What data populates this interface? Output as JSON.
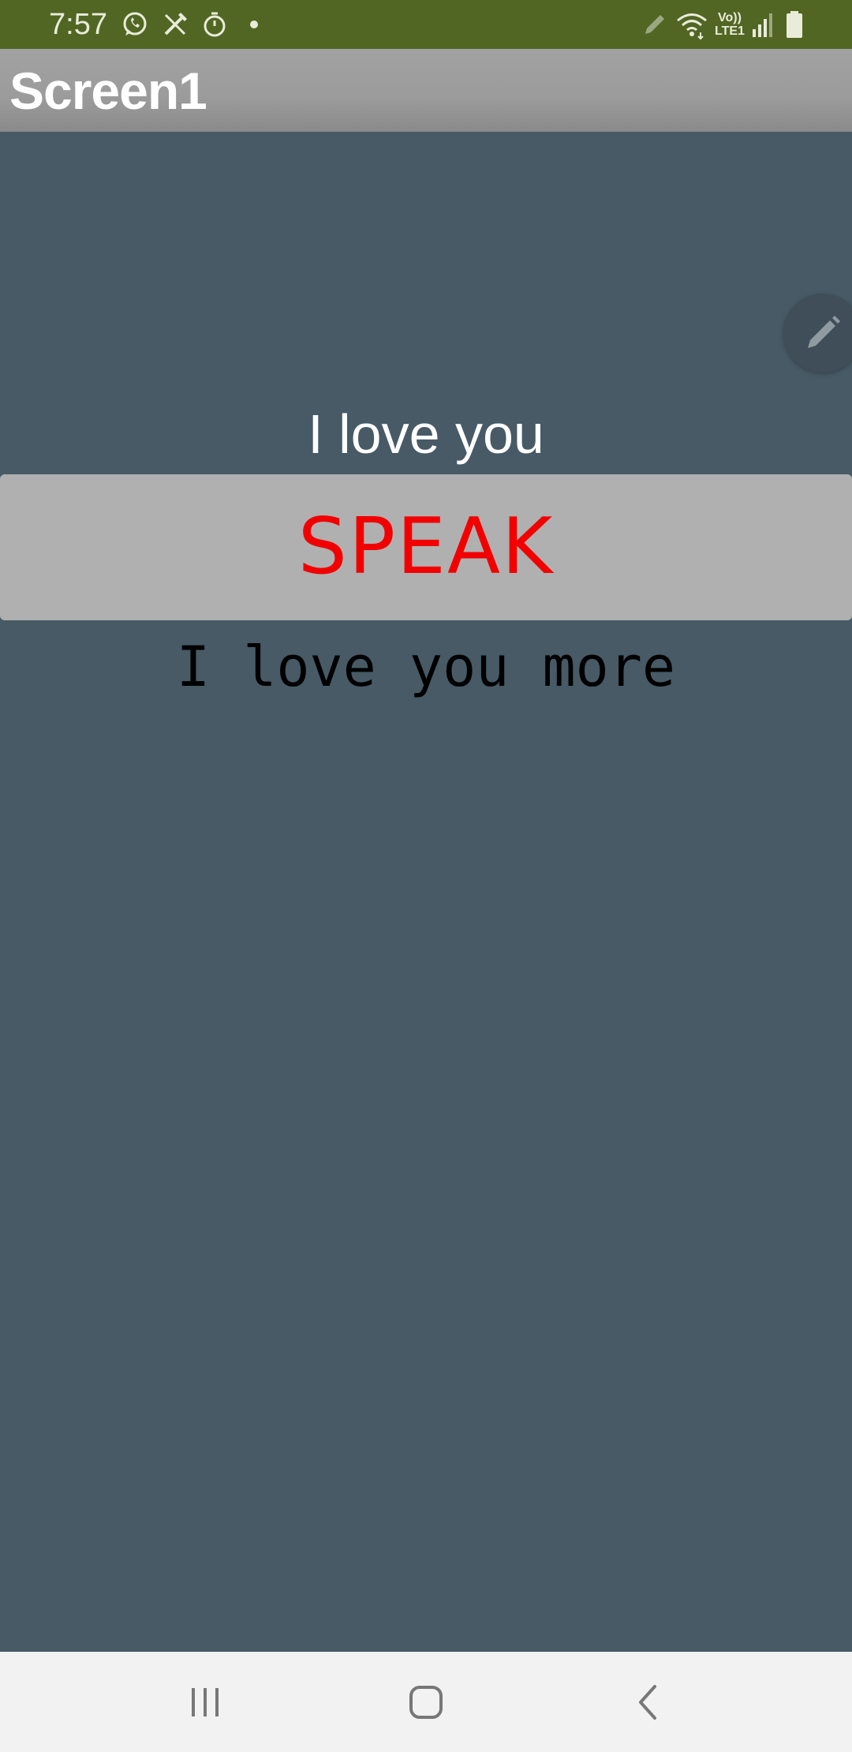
{
  "status_bar": {
    "time": "7:57",
    "network_line1": "Vo))",
    "network_line2": "LTE1",
    "background": "#526624",
    "icons": [
      "whatsapp-icon",
      "pen-tool-icon",
      "timer-icon",
      "notification-dot-icon",
      "edit-pencil-icon",
      "wifi-icon",
      "signal-icon",
      "battery-icon"
    ]
  },
  "title_bar": {
    "title": "Screen1"
  },
  "main": {
    "label_top": "I love you",
    "speak_button": "SPEAK",
    "label_bottom": "I love you more",
    "background": "#475a66",
    "button_text_color": "#f20000"
  },
  "fab": {
    "icon": "pencil-icon"
  },
  "nav_bar": {
    "buttons": [
      "recent-apps-icon",
      "home-icon",
      "back-icon"
    ]
  }
}
